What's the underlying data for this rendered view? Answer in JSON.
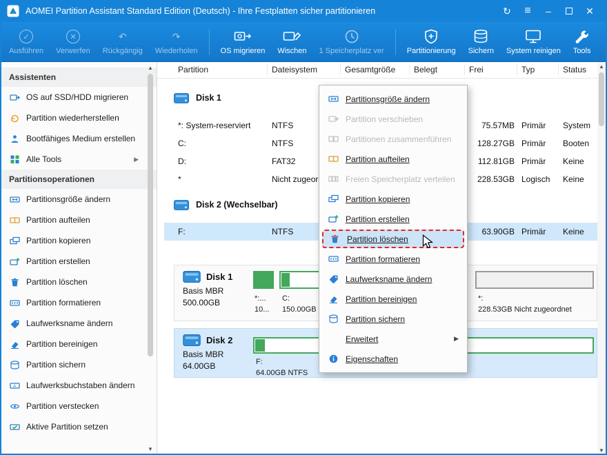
{
  "titlebar": {
    "title": "AOMEI Partition Assistant Standard Edition (Deutsch) - Ihre Festplatten sicher partitionieren"
  },
  "icons": {
    "refresh": "↻",
    "hamburger": "≡",
    "minimize": "–",
    "close": "✕",
    "execute": "✓",
    "discard": "✕",
    "undo": "↶",
    "redo": "↷",
    "up_arrow": "▲",
    "down_arrow": "▼",
    "submenu_arrow": "▶"
  },
  "colors": {
    "titlebar_blue": "#1583d7",
    "selection_blue": "#cfe8fb",
    "annotation_red": "#e8231d",
    "partition_green": "#43a85c"
  },
  "toolbar": {
    "items": [
      {
        "label": "Ausführen",
        "icon": "apply-icon",
        "disabled": true
      },
      {
        "label": "Verwerfen",
        "icon": "discard-icon",
        "disabled": true
      },
      {
        "label": "Rückgängig",
        "icon": "undo-icon",
        "disabled": true
      },
      {
        "label": "Wiederholen",
        "icon": "redo-icon",
        "disabled": true
      },
      {
        "label": "OS migrieren",
        "icon": "migrate-os-icon",
        "disabled": false
      },
      {
        "label": "Wischen",
        "icon": "wipe-disk-icon",
        "disabled": false
      },
      {
        "label": "1 Speicherplatz ver",
        "icon": "clock-icon",
        "disabled": true
      },
      {
        "label": "Partitionierung",
        "icon": "shield-partition-icon",
        "disabled": false
      },
      {
        "label": "Sichern",
        "icon": "backup-disks-icon",
        "disabled": false
      },
      {
        "label": "System reinigen",
        "icon": "clean-system-icon",
        "disabled": false
      },
      {
        "label": "Tools",
        "icon": "wrench-icon",
        "disabled": false
      }
    ]
  },
  "sidebar": {
    "sections": [
      {
        "title": "Assistenten",
        "items": [
          {
            "label": "OS auf SSD/HDD migrieren",
            "icon": "os-migrate-icon"
          },
          {
            "label": "Partition wiederherstellen",
            "icon": "partition-restore-icon"
          },
          {
            "label": "Bootfähiges Medium erstellen",
            "icon": "bootable-media-icon"
          },
          {
            "label": "Alle Tools",
            "icon": "all-tools-icon",
            "has_submenu": true
          }
        ]
      },
      {
        "title": "Partitionsoperationen",
        "items": [
          {
            "label": "Partitionsgröße ändern",
            "icon": "resize-partition-icon"
          },
          {
            "label": "Partition aufteilen",
            "icon": "split-partition-icon"
          },
          {
            "label": "Partition kopieren",
            "icon": "copy-partition-icon"
          },
          {
            "label": "Partition erstellen",
            "icon": "create-partition-icon"
          },
          {
            "label": "Partition löschen",
            "icon": "delete-partition-icon"
          },
          {
            "label": "Partition formatieren",
            "icon": "format-partition-icon"
          },
          {
            "label": "Laufwerksname ändern",
            "icon": "drive-label-icon"
          },
          {
            "label": "Partition bereinigen",
            "icon": "wipe-partition-icon"
          },
          {
            "label": "Partition sichern",
            "icon": "backup-partition-icon"
          },
          {
            "label": "Laufwerksbuchstaben ändern",
            "icon": "drive-letter-icon"
          },
          {
            "label": "Partition verstecken",
            "icon": "hide-partition-icon"
          },
          {
            "label": "Aktive Partition setzen",
            "icon": "set-active-icon"
          }
        ]
      }
    ]
  },
  "table": {
    "columns": [
      "Partition",
      "Dateisystem",
      "Gesamtgröße",
      "Belegt",
      "Frei",
      "Typ",
      "Status"
    ],
    "groups": [
      {
        "label": "Disk 1",
        "rows": [
          {
            "partition": "*: System-reserviert",
            "filesystem": "NTFS",
            "frei": "75.57MB",
            "typ": "Primär",
            "status": "System"
          },
          {
            "partition": "C:",
            "filesystem": "NTFS",
            "frei": "128.27GB",
            "typ": "Primär",
            "status": "Booten"
          },
          {
            "partition": "D:",
            "filesystem": "FAT32",
            "frei": "112.81GB",
            "typ": "Primär",
            "status": "Keine"
          },
          {
            "partition": "*",
            "filesystem": "Nicht zugeordnet",
            "frei": "228.53GB",
            "typ": "Logisch",
            "status": "Keine"
          }
        ]
      },
      {
        "label": "Disk 2 (Wechselbar)",
        "rows": [
          {
            "partition": "F:",
            "filesystem": "NTFS",
            "frei": "63.90GB",
            "typ": "Primär",
            "status": "Keine"
          }
        ]
      }
    ]
  },
  "context_menu": {
    "items": [
      {
        "label": "Partitionsgröße ändern",
        "icon": "resize-partition-icon",
        "disabled": false
      },
      {
        "label": "Partition verschieben",
        "icon": "move-partition-icon",
        "disabled": true
      },
      {
        "label": "Partitionen zusammenführen",
        "icon": "merge-partition-icon",
        "disabled": true
      },
      {
        "label": "Partition aufteilen",
        "icon": "split-partition-icon",
        "disabled": false
      },
      {
        "label": "Freien Speicherplatz verteilen",
        "icon": "distribute-space-icon",
        "disabled": true
      },
      {
        "label": "Partition kopieren",
        "icon": "copy-partition-icon",
        "disabled": false
      },
      {
        "label": "Partition erstellen",
        "icon": "create-partition-icon",
        "disabled": false
      },
      {
        "label": "Partition löschen",
        "icon": "delete-partition-icon",
        "disabled": false,
        "highlighted": true
      },
      {
        "label": "Partition formatieren",
        "icon": "format-partition-icon",
        "disabled": false
      },
      {
        "label": "Laufwerksname ändern",
        "icon": "drive-label-icon",
        "disabled": false
      },
      {
        "label": "Partition bereinigen",
        "icon": "wipe-partition-icon",
        "disabled": false
      },
      {
        "label": "Partition sichern",
        "icon": "backup-partition-icon",
        "disabled": false
      },
      {
        "label": "Erweitert",
        "icon": "",
        "disabled": false,
        "has_submenu": true
      },
      {
        "label": "Eigenschaften",
        "icon": "info-icon",
        "disabled": false
      }
    ]
  },
  "disk_map": {
    "disk1": {
      "name": "Disk 1",
      "type": "Basis MBR",
      "size": "500.00GB",
      "partitions": [
        {
          "line1": "*:...",
          "line2": "10..."
        },
        {
          "line1": "C:",
          "line2": "150.00GB"
        },
        {
          "line1": "*:",
          "line2": "228.53GB Nicht zugeordnet"
        }
      ]
    },
    "disk2": {
      "name": "Disk 2",
      "type": "Basis MBR",
      "size": "64.00GB",
      "partitions": [
        {
          "line1": "F:",
          "line2": "64.00GB NTFS"
        }
      ]
    }
  }
}
